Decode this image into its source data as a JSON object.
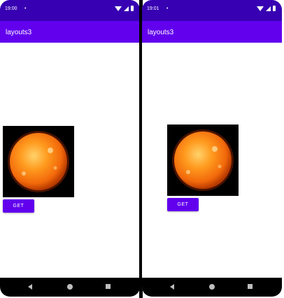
{
  "screens": [
    {
      "status_time": "19:00",
      "status_dot": "•",
      "app_title": "layouts3",
      "button_label": "GET"
    },
    {
      "status_time": "19:01",
      "status_dot": "•",
      "app_title": "layouts3",
      "button_label": "GET"
    }
  ],
  "colors": {
    "status_bar": "#3700b3",
    "app_bar": "#6200ee",
    "button": "#6200ee",
    "nav_bar": "#000000"
  },
  "icons": {
    "status": [
      "wifi-icon",
      "signal-icon",
      "battery-icon"
    ],
    "nav": [
      "back-icon",
      "home-icon",
      "recents-icon"
    ]
  }
}
